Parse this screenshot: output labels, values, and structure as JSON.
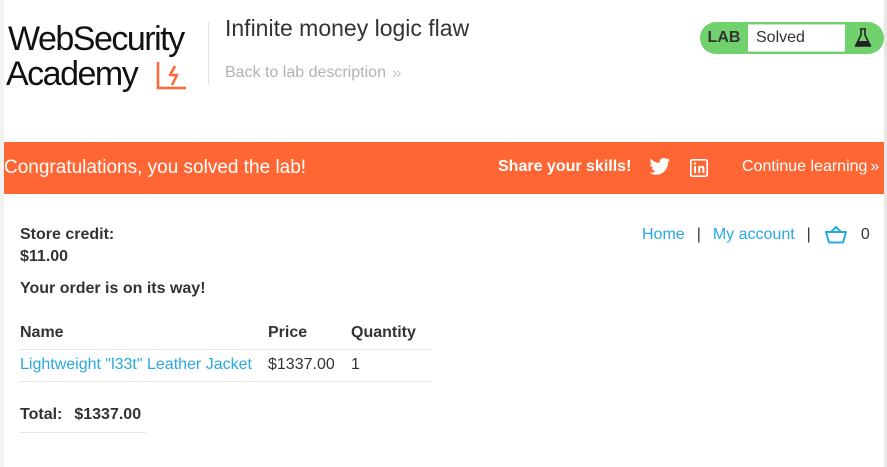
{
  "logo": {
    "line1": "WebSecurity",
    "line2": "Academy",
    "mark_color": "#ff6633"
  },
  "header": {
    "title": "Infinite money logic flaw",
    "back_link": "Back to lab description",
    "back_chevron": "»"
  },
  "lab_status": {
    "label": "LAB",
    "state": "Solved",
    "icon": "flask-icon",
    "color": "#70d16d"
  },
  "banner": {
    "message": "Congratulations, you solved the lab!",
    "share_label": "Share your skills!",
    "continue_label": "Continue learning",
    "continue_chevron": "»",
    "color": "#ff6633"
  },
  "account": {
    "store_credit_label": "Store credit:",
    "store_credit_value": "$11.00",
    "order_message": "Your order is on its way!"
  },
  "nav": {
    "home": "Home",
    "separator": "|",
    "my_account": "My account",
    "cart_count": "0"
  },
  "order_table": {
    "headers": [
      "Name",
      "Price",
      "Quantity"
    ],
    "rows": [
      {
        "name": "Lightweight \"l33t\" Leather Jacket",
        "price": "$1337.00",
        "quantity": "1"
      }
    ]
  },
  "total": {
    "label": "Total:",
    "value": "$1337.00"
  },
  "colors": {
    "link": "#29a9e1",
    "text": "#333332"
  }
}
